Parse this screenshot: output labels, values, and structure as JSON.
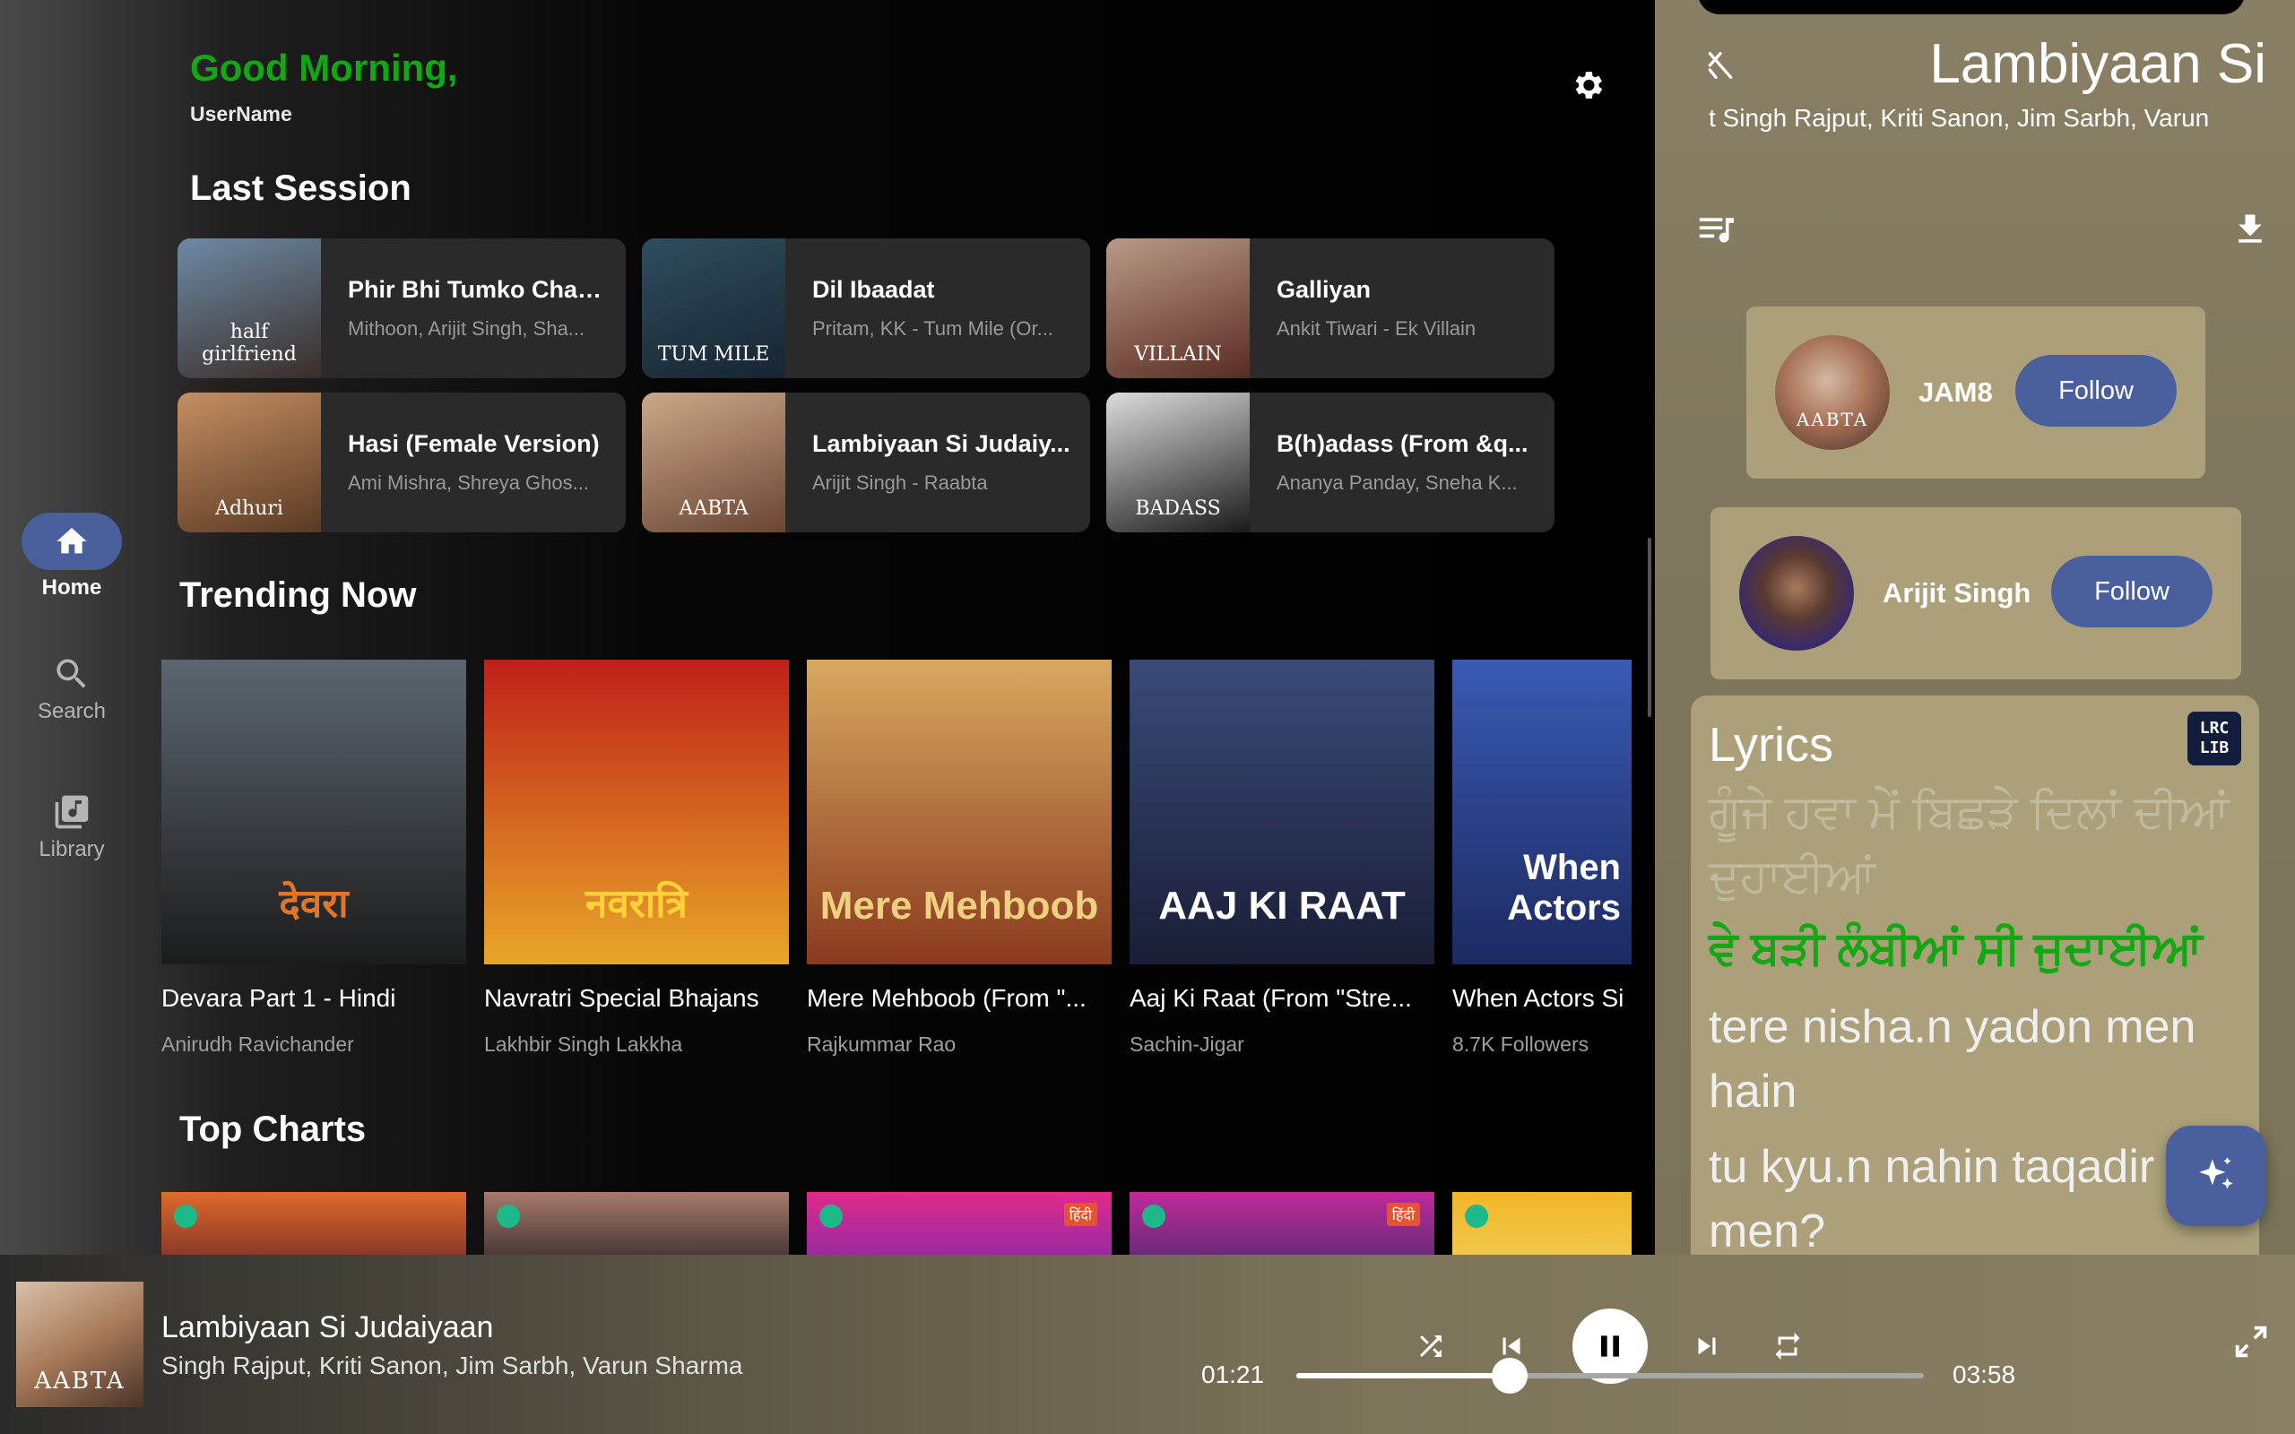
{
  "header": {
    "greeting": "Good Morning,",
    "username": "UserName"
  },
  "nav": {
    "home": "Home",
    "search": "Search",
    "library": "Library"
  },
  "last_session": {
    "title": "Last Session",
    "items": [
      {
        "title": "Phir Bhi Tumko Chaa...",
        "subtitle": "Mithoon, Arijit Singh, Sha...",
        "thumb_text": "half girlfriend",
        "color1": "#6e8aa6",
        "color2": "#3a2e28"
      },
      {
        "title": "Dil Ibaadat",
        "subtitle": "Pritam, KK - Tum Mile (Or...",
        "thumb_text": "TUM MILE",
        "color1": "#2f4d60",
        "color2": "#172530"
      },
      {
        "title": "Galliyan",
        "subtitle": "Ankit Tiwari - Ek Villain",
        "thumb_text": "VILLAIN",
        "color1": "#b89a86",
        "color2": "#5b2b22"
      },
      {
        "title": "Hasi (Female Version)",
        "subtitle": "Ami Mishra, Shreya Ghos...",
        "thumb_text": "Adhuri",
        "color1": "#c48e62",
        "color2": "#5a3a24"
      },
      {
        "title": "Lambiyaan Si Judaiy...",
        "subtitle": "Arijit Singh - Raabta",
        "thumb_text": "AABTA",
        "color1": "#caa88a",
        "color2": "#6a4632"
      },
      {
        "title": "B(h)adass (From &q...",
        "subtitle": "Ananya Panday, Sneha K...",
        "thumb_text": "BADASS",
        "color1": "#dcdcdc",
        "color2": "#1a1a1a"
      }
    ]
  },
  "trending": {
    "title": "Trending Now",
    "items": [
      {
        "title": "Devara Part 1 - Hindi",
        "subtitle": "Anirudh Ravichander",
        "art_text": "देवरा",
        "color1": "#5c6670",
        "color2": "#1c1c1c",
        "accent": "#e0762a"
      },
      {
        "title": "Navratri Special Bhajans",
        "subtitle": "Lakhbir Singh Lakkha",
        "art_text": "नवरात्रि",
        "color1": "#c0201a",
        "color2": "#e8a628",
        "accent": "#ffd23a"
      },
      {
        "title": "Mere Mehboob (From \"...",
        "subtitle": "Rajkummar Rao",
        "art_text": "Mere Mehboob",
        "color1": "#d8a860",
        "color2": "#8a3a1e",
        "accent": "#f0d080"
      },
      {
        "title": "Aaj Ki Raat (From \"Stre...",
        "subtitle": "Sachin-Jigar",
        "art_text": "AAJ KI RAAT",
        "color1": "#3a4a78",
        "color2": "#1a1e36",
        "accent": "#ffffff"
      },
      {
        "title": "When Actors Si",
        "subtitle": "8.7K Followers",
        "art_text": "When Actors",
        "color1": "#3a5ab4",
        "color2": "#1c2a60",
        "accent": "#ffffff"
      }
    ]
  },
  "top_charts": {
    "title": "Top Charts",
    "items": [
      {
        "color1": "#e06a2a",
        "color2": "#8a3a2a",
        "hindi": ""
      },
      {
        "color1": "#a87a6a",
        "color2": "#4a3a38",
        "hindi": ""
      },
      {
        "color1": "#e02a8a",
        "color2": "#9a2aa0",
        "hindi": "हिंदी"
      },
      {
        "color1": "#c02a9a",
        "color2": "#6a2a7a",
        "hindi": "हिंदी"
      },
      {
        "color1": "#f2b628",
        "color2": "#f0c84a",
        "hindi": ""
      }
    ]
  },
  "now_playing_panel": {
    "title": "Lambiyaan Si",
    "artists": "t Singh Rajput, Kriti Sanon, Jim Sarbh, Varun",
    "artists_list": [
      {
        "name": "JAM8",
        "follow_label": "Follow"
      },
      {
        "name": "Arijit Singh",
        "follow_label": "Follow"
      }
    ],
    "lyrics": {
      "heading": "Lyrics",
      "badge": "LRC LIB",
      "lines": [
        {
          "text": "ਗੂੰਜੇ ਹਵਾ ਮੇਂ ਬਿਛੜੇ ਦਿਲਾਂ ਦੀਆਂ ਦੁਹਾਈਆਂ",
          "state": "past"
        },
        {
          "text": "ਵੇ ਬੜੀ ਲੰਬੀਆਂ ਸੀ ਜੁਦਾਈਆਂ",
          "state": "current"
        },
        {
          "text": "tere nisha.n yadon men hain",
          "state": "future"
        },
        {
          "text": "tu kyu.n nahin taqadir men?",
          "state": "future"
        }
      ]
    }
  },
  "player": {
    "title": "Lambiyaan Si Judaiyaan",
    "artists": "Singh Rajput, Kriti Sanon, Jim Sarbh, Varun Sharma",
    "elapsed": "01:21",
    "duration": "03:58",
    "progress": 0.34,
    "playing": true
  },
  "colors": {
    "accent_blue": "#4a5f9e",
    "greeting_green": "#13a813",
    "panel_tan": "#aba07a"
  }
}
